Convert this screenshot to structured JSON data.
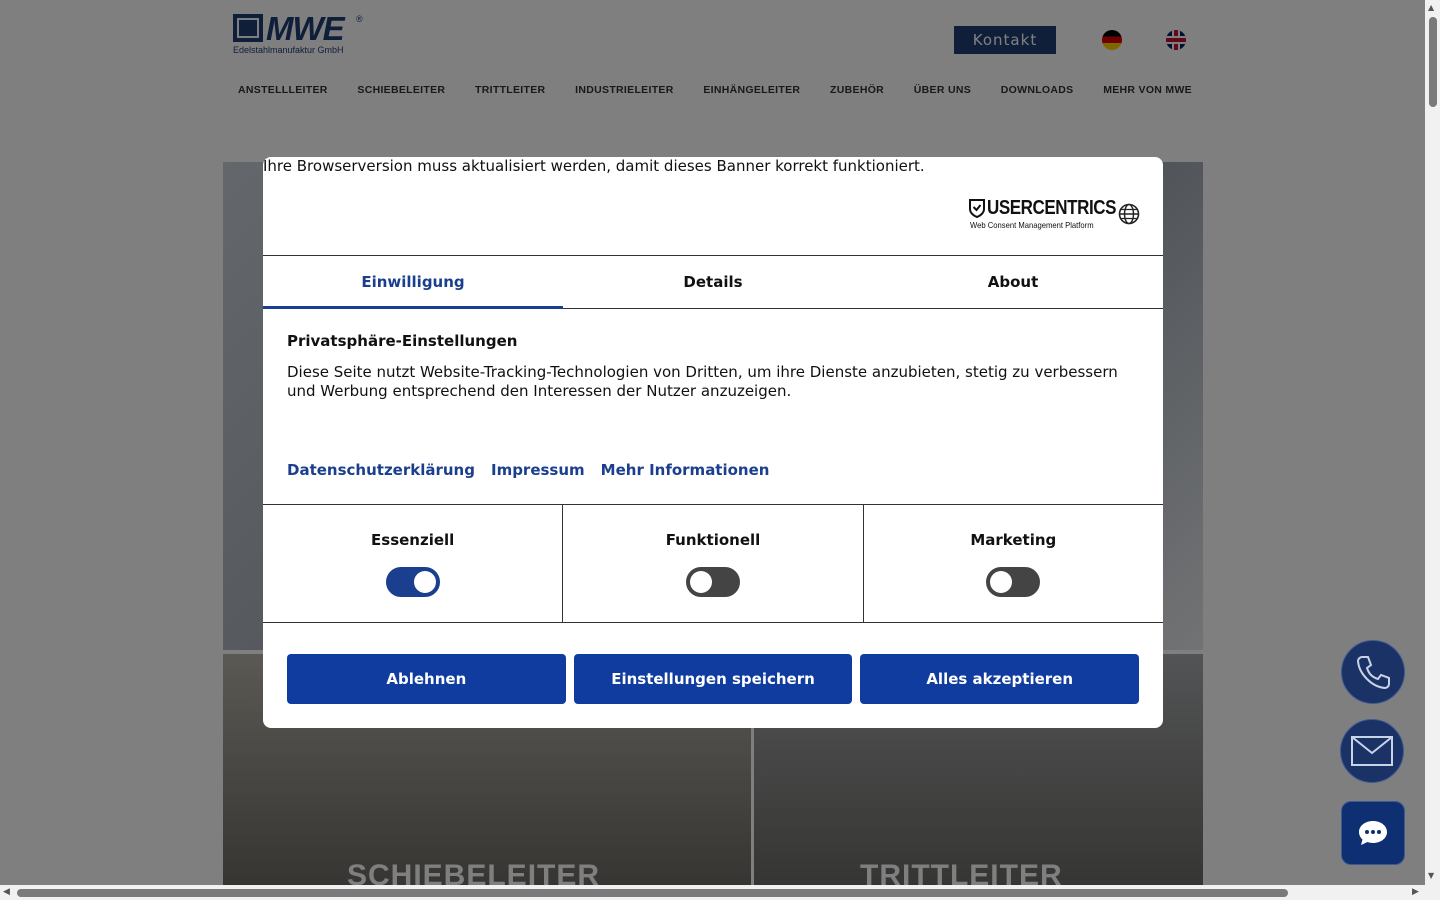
{
  "site": {
    "logo_text": "MWE",
    "logo_reg": "®",
    "logo_sub": "Edelstahlmanufaktur GmbH",
    "kontakt": "Kontakt",
    "nav": [
      "ANSTELLLEITER",
      "SCHIEBELEITER",
      "TRITTLEITER",
      "INDUSTRIELEITER",
      "EINHÄNGELEITER",
      "ZUBEHÖR",
      "ÜBER UNS",
      "DOWNLOADS",
      "MEHR VON MWE"
    ],
    "tiles": [
      "SCHIEBELEITER",
      "TRITTLEITER"
    ]
  },
  "banner": {
    "browser_warning": "Ihre Browserversion muss aktualisiert werden, damit dieses Banner korrekt funktioniert.",
    "provider_title": "USERCENTRICS",
    "provider_sub": "Web Consent Management Platform",
    "tabs": [
      "Einwilligung",
      "Details",
      "About"
    ],
    "active_tab": "Einwilligung",
    "privacy_title": "Privatsphäre-Einstellungen",
    "privacy_text": "Diese Seite nutzt Website-Tracking-Technologien von Dritten, um ihre Dienste anzubieten, stetig zu verbessern und Werbung entsprechend den Interessen der Nutzer anzuzeigen.",
    "links": [
      "Datenschutzerklärung",
      "Impressum",
      "Mehr Informationen"
    ],
    "categories": [
      {
        "label": "Essenziell",
        "enabled": true
      },
      {
        "label": "Funktionell",
        "enabled": false
      },
      {
        "label": "Marketing",
        "enabled": false
      }
    ],
    "buttons": {
      "reject": "Ablehnen",
      "save": "Einstellungen speichern",
      "accept_all": "Alles akzeptieren"
    }
  },
  "colors": {
    "brand": "#1f3f73",
    "accent": "#0f3c9e",
    "active_tab": "#1b3f8f"
  },
  "icons": {
    "phone": "phone-icon",
    "mail": "mail-icon",
    "chat": "chat-icon",
    "globe": "globe-icon"
  }
}
